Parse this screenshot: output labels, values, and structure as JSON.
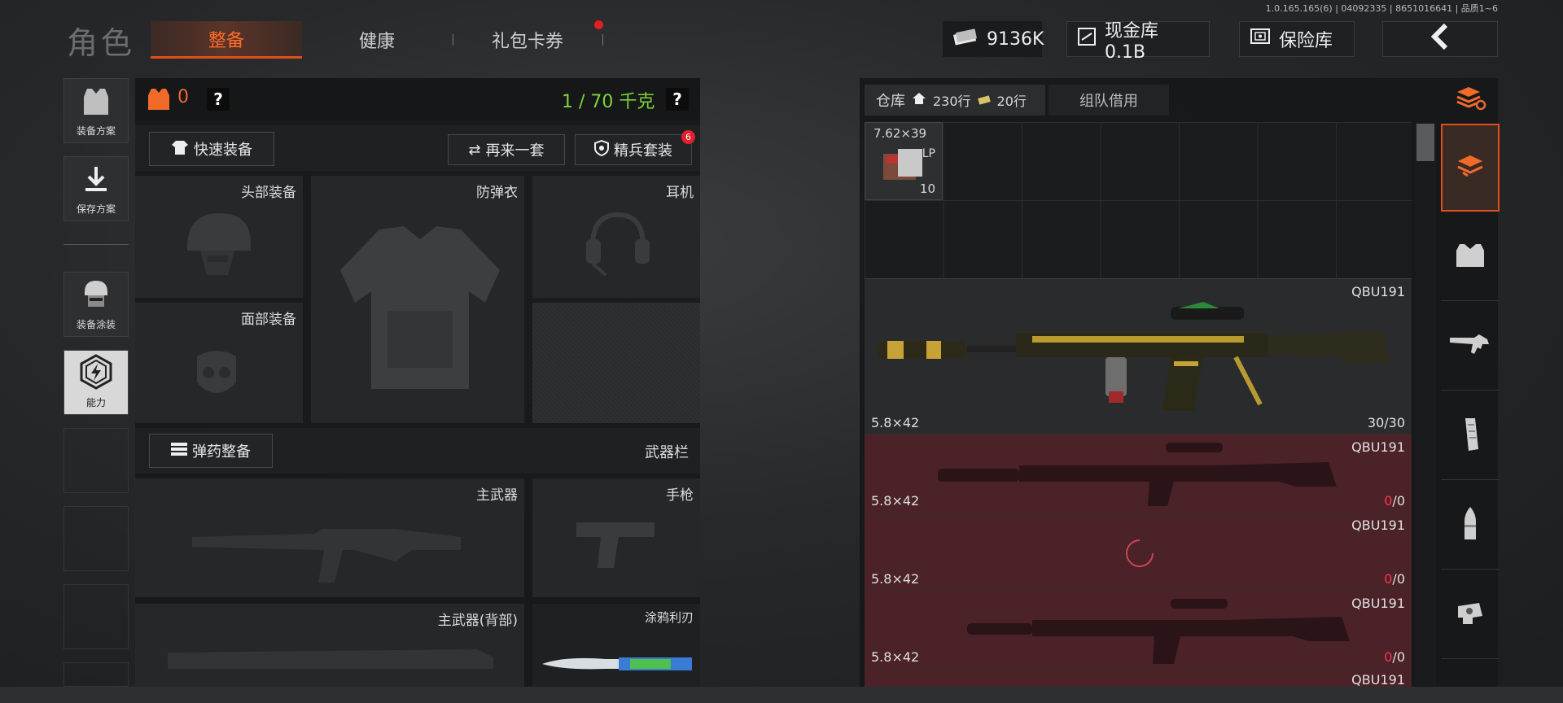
{
  "version": "1.0.165.165(6) | 04092335 | 8651016641 | 品质1~6",
  "header": {
    "title": "角色",
    "tabs": [
      {
        "label": "整备",
        "active": true
      },
      {
        "label": "健康",
        "active": false
      },
      {
        "label": "礼包卡券",
        "active": false,
        "dot": true
      }
    ],
    "currency": "9136K",
    "cash_vault": "现金库 0.1B",
    "safe": "保险库"
  },
  "sidebar": {
    "items": [
      {
        "label": "装备方案",
        "icon": "vest-icon"
      },
      {
        "label": "保存方案",
        "icon": "download-icon"
      },
      {
        "label": "装备涂装",
        "icon": "helmet-mask-icon"
      },
      {
        "label": "能力",
        "icon": "lightning-hex-icon",
        "active": true
      }
    ]
  },
  "loadout": {
    "armor_count": "0",
    "help": "?",
    "weight": "1 / 70 千克",
    "quick_equip": "快速装备",
    "again": "再来一套",
    "elite_set": "精兵套装",
    "elite_badge": "6",
    "slots": {
      "head": "头部装备",
      "vest": "防弹衣",
      "headset": "耳机",
      "face": "面部装备"
    },
    "ammo_equip": "弹药整备",
    "weapon_bar": "武器栏",
    "weapons": {
      "primary": "主武器",
      "pistol": "手枪",
      "primary_back": "主武器(背部)",
      "melee": "涂鸦利刃"
    }
  },
  "warehouse": {
    "tab_label": "仓库",
    "home_rows": "230行",
    "ticket_rows": "20行",
    "team_borrow": "组队借用",
    "ammo_item": {
      "caliber": "7.62×39",
      "tag": "LP",
      "count": "10"
    },
    "rows": [
      {
        "name": "QBU191",
        "caliber": "5.8×42",
        "ammo_cur": "30",
        "ammo_max": "/30",
        "locked": false
      },
      {
        "name": "QBU191",
        "caliber": "5.8×42",
        "ammo_cur": "0",
        "ammo_max": "/0",
        "locked": true
      },
      {
        "name": "QBU191",
        "caliber": "5.8×42",
        "ammo_cur": "0",
        "ammo_max": "/0",
        "locked": true
      },
      {
        "name": "QBU191",
        "caliber": "5.8×42",
        "ammo_cur": "0",
        "ammo_max": "/0",
        "locked": true
      },
      {
        "name": "QBU191",
        "caliber": "",
        "ammo_cur": "",
        "ammo_max": "",
        "locked": true
      }
    ]
  },
  "right_rail": {
    "icons": [
      "layers-refresh-icon",
      "layers-icon",
      "armor-icon",
      "rifle-icon",
      "magazine-icon",
      "bullet-icon",
      "scope-icon"
    ]
  },
  "colors": {
    "accent": "#e0501e",
    "weight_green": "#7cd33a",
    "locked_bg": "#4a2228"
  }
}
